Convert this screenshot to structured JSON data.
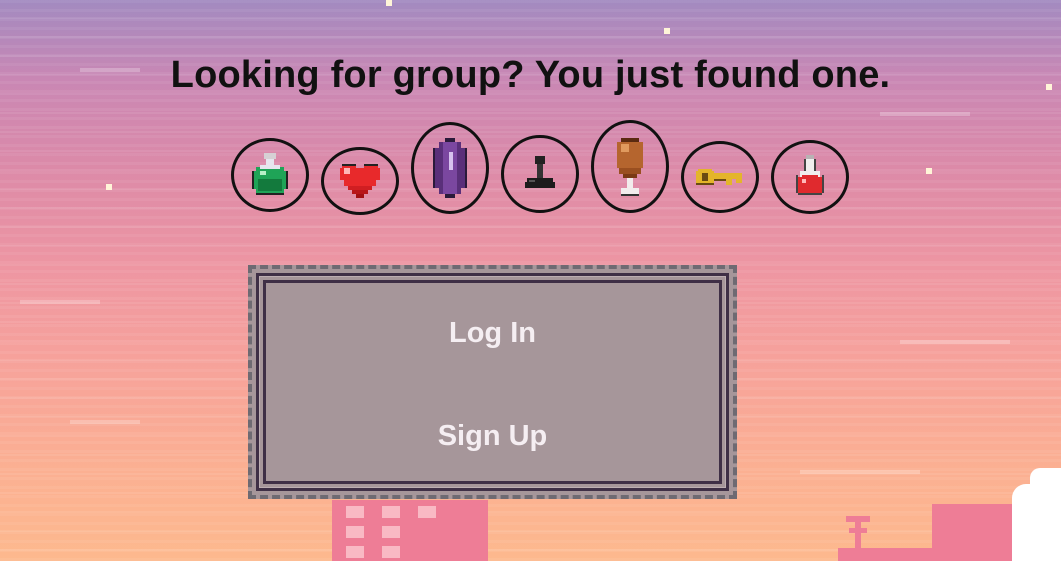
{
  "headline": "Looking for group? You just found one.",
  "icons": [
    {
      "name": "green-potion"
    },
    {
      "name": "heart"
    },
    {
      "name": "purple-crystal"
    },
    {
      "name": "joystick"
    },
    {
      "name": "drumstick"
    },
    {
      "name": "golden-key"
    },
    {
      "name": "red-potion"
    }
  ],
  "menu": {
    "login_label": "Log In",
    "signup_label": "Sign Up"
  },
  "colors": {
    "panel_bg": "#a6969a",
    "panel_border": "#3f2f46",
    "sky_top": "#a28ac0",
    "sky_bottom": "#fdb98e",
    "building": "#ee7d96"
  }
}
